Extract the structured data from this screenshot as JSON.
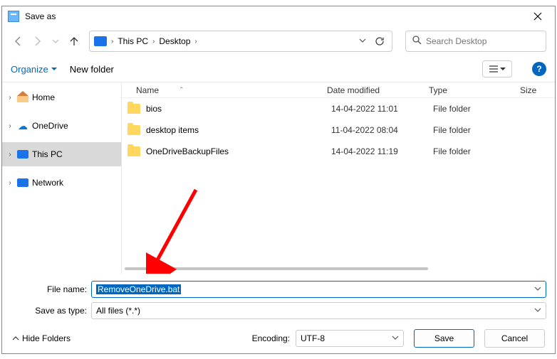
{
  "window": {
    "title": "Save as"
  },
  "breadcrumb": {
    "root": "This PC",
    "folder": "Desktop"
  },
  "search": {
    "placeholder": "Search Desktop"
  },
  "toolbar": {
    "organize": "Organize",
    "newfolder": "New folder",
    "help": "?"
  },
  "sidebar": {
    "items": [
      {
        "label": "Home"
      },
      {
        "label": "OneDrive"
      },
      {
        "label": "This PC"
      },
      {
        "label": "Network"
      }
    ]
  },
  "columns": {
    "name": "Name",
    "date": "Date modified",
    "type": "Type",
    "size": "Size"
  },
  "rows": [
    {
      "name": "bios",
      "date": "14-04-2022 11:01",
      "type": "File folder"
    },
    {
      "name": "desktop items",
      "date": "11-04-2022 08:04",
      "type": "File folder"
    },
    {
      "name": "OneDriveBackupFiles",
      "date": "14-04-2022 11:19",
      "type": "File folder"
    }
  ],
  "fields": {
    "filename_label": "File name:",
    "filename_value": "RemoveOneDrive.bat",
    "saveastype_label": "Save as type:",
    "saveastype_value": "All files  (*.*)"
  },
  "footer": {
    "hidefolders": "Hide Folders",
    "encoding_label": "Encoding:",
    "encoding_value": "UTF-8",
    "save": "Save",
    "cancel": "Cancel"
  }
}
